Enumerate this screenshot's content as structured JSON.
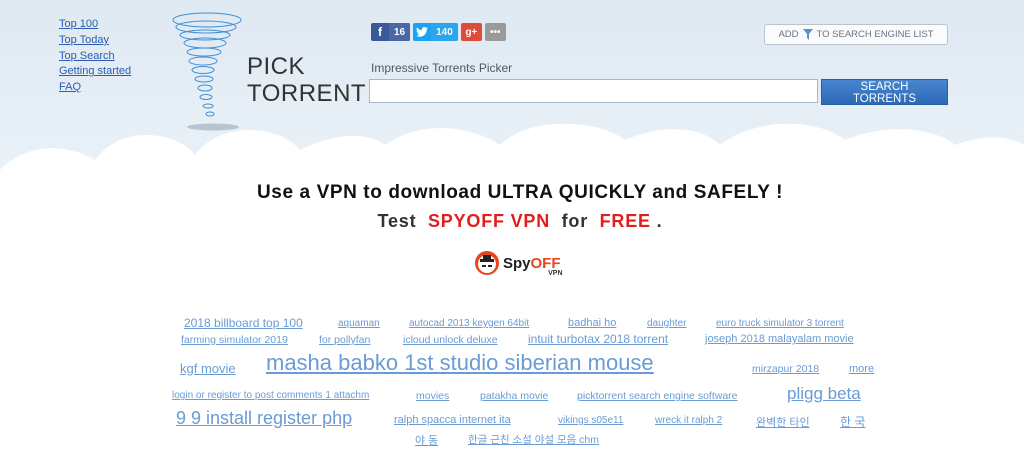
{
  "nav": {
    "links": [
      "Top 100",
      "Top Today",
      "Top Search",
      "Getting started",
      "FAQ"
    ]
  },
  "logo": {
    "line1": "PICK",
    "line2": "TORRENT"
  },
  "social": {
    "facebook_count": "16",
    "twitter_count": "140",
    "gplus": "g+",
    "more": "•••"
  },
  "add_button": {
    "prefix": "ADD",
    "suffix": "TO SEARCH ENGINE LIST"
  },
  "search": {
    "tagline": "Impressive Torrents Picker",
    "value": "",
    "button_label": "SEARCH TORRENTS"
  },
  "promo": {
    "line1": "Use a VPN to download ULTRA QUICKLY and SAFELY !",
    "test": "Test",
    "brand": "SPYOFF VPN",
    "for": "for",
    "free": "FREE",
    "period": ".",
    "logo_spy": "Spy",
    "logo_off": "OFF",
    "logo_vpn": "VPN"
  },
  "tags": [
    "2018 billboard top 100",
    "aquaman",
    "autocad 2013 keygen 64bit",
    "badhai ho",
    "daughter",
    "euro truck simulator 3 torrent",
    "farming simulator 2019",
    "for pollyfan",
    "icloud unlock deluxe",
    "intuit turbotax 2018 torrent",
    "joseph 2018 malayalam movie",
    "kgf movie",
    "masha babko 1st studio siberian mouse",
    "mirzapur 2018",
    "more",
    "login or register to post comments 1 attachm",
    "movies",
    "patakha movie",
    "picktorrent search engine software",
    "pligg beta",
    "9 9 install register php",
    "ralph spacca internet ita",
    "vikings s05e11",
    "wreck it ralph 2",
    "완벽한 타인",
    "한 국",
    "야 동",
    "한글 근친 소설 야설 모음 chm"
  ],
  "colors": {
    "link": "#2a5db0",
    "tag": "#6a9bd4",
    "promo_red": "#e21d1d",
    "search_button": "#3575c2"
  }
}
